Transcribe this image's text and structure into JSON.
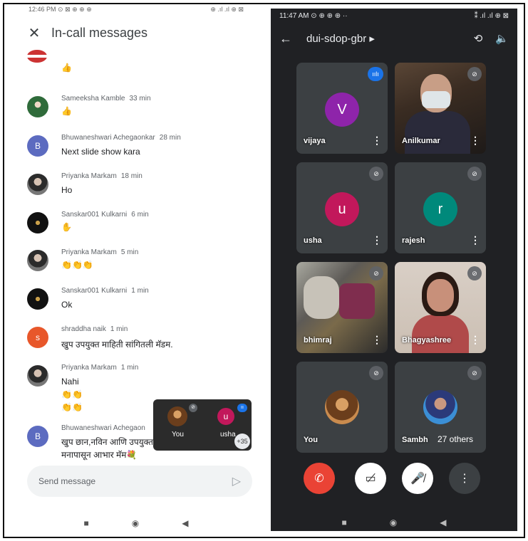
{
  "left": {
    "status": {
      "left": "12:46 PM ⊙ ⊠ ⊕ ⊕ ⊕",
      "right": "⊕ .ıl .ıl ⊕ ⊠"
    },
    "header": {
      "title": "In-call messages",
      "close_icon": "close-icon"
    },
    "messages": [
      {
        "sender": "",
        "time": "",
        "text": "👍",
        "avatar_type": "flag"
      },
      {
        "sender": "Sameeksha Kamble",
        "time": "33 min",
        "text": "👍",
        "avatar_type": "green"
      },
      {
        "sender": "Bhuwaneshwari Achegaonkar",
        "time": "28 min",
        "text": "Next slide show kara",
        "avatar_letter": "B",
        "avatar_color": "#5c6bc0"
      },
      {
        "sender": "Priyanka Markam",
        "time": "18 min",
        "text": "Ho",
        "avatar_type": "girl"
      },
      {
        "sender": "Sanskar001 Kulkarni",
        "time": "6 min",
        "text": "✋",
        "avatar_type": "logo"
      },
      {
        "sender": "Priyanka Markam",
        "time": "5 min",
        "text": "👏👏👏",
        "avatar_type": "girl"
      },
      {
        "sender": "Sanskar001 Kulkarni",
        "time": "1 min",
        "text": "Ok",
        "avatar_type": "logo"
      },
      {
        "sender": "shraddha naik",
        "time": "1 min",
        "text": "खुप उपयुक्त माहिती सांगितली मॅडम.",
        "avatar_letter": "s",
        "avatar_color": "#e8572a"
      },
      {
        "sender": "Priyanka Markam",
        "time": "1 min",
        "text": "Nahi",
        "text2": "👏👏",
        "text3": "👏👏",
        "avatar_type": "girl"
      },
      {
        "sender": "Bhuwaneshwari Achegaon",
        "time": "",
        "text": "खुप छान,नविन आणि उपयुक्त",
        "text2": "मनापासून आभार मॅम💐",
        "avatar_letter": "B",
        "avatar_color": "#5c6bc0"
      }
    ],
    "pip": {
      "you_label": "You",
      "usha_letter": "u",
      "usha_label": "usha",
      "count": "+35"
    },
    "composer": {
      "placeholder": "Send message",
      "send_icon": "send-icon"
    },
    "nav": {
      "recent": "■",
      "home": "◉",
      "back": "◀"
    }
  },
  "right": {
    "status": {
      "time": "11:47 AM ⊙ ⊕ ⊕ ⊕ ··",
      "icons": "⁑ .ıl .ıl ⊕ ⊠"
    },
    "header": {
      "meeting_code": "dui-sdop-gbr ▸",
      "back_icon": "arrow-left-icon",
      "camera_switch_icon": "camera-switch-icon",
      "speaker_icon": "speaker-icon"
    },
    "tiles": [
      {
        "name": "vijaya",
        "kind": "letter",
        "letter": "V",
        "color": "#8e24aa",
        "state": "speaking"
      },
      {
        "name": "Anilkumar",
        "kind": "camera-anil",
        "state": "muted"
      },
      {
        "name": "usha",
        "kind": "letter",
        "letter": "u",
        "color": "#c2185b",
        "state": "muted"
      },
      {
        "name": "rajesh",
        "kind": "letter",
        "letter": "r",
        "color": "#00897b",
        "state": "muted"
      },
      {
        "name": "bhimraj",
        "kind": "camera-bhim",
        "state": "muted"
      },
      {
        "name": "Bhagyashree",
        "kind": "camera-bhag",
        "state": "muted"
      },
      {
        "name": "You",
        "kind": "photo-you",
        "state": "muted"
      },
      {
        "name": "Sambh",
        "kind": "photo-sambh",
        "state": "muted"
      }
    ],
    "others": "27 others",
    "controls": {
      "end": "end-call-button",
      "camera": "camera-off-button",
      "mic": "mic-off-button",
      "more": "more-options-button"
    },
    "nav": {
      "recent": "■",
      "home": "◉",
      "back": "◀"
    }
  }
}
